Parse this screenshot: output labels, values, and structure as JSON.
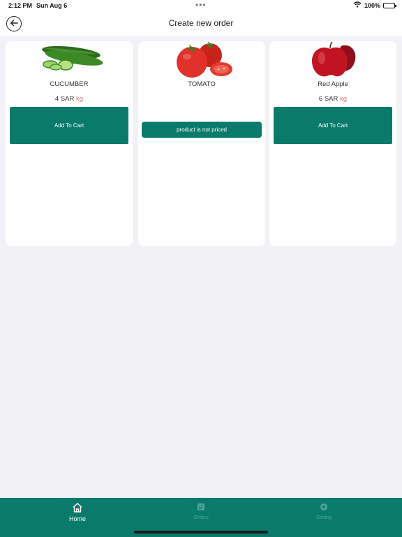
{
  "status_bar": {
    "time": "2:12 PM",
    "date": "Sun Aug 6",
    "dots": "•••",
    "battery_percent": "100%"
  },
  "header": {
    "title": "Create new order",
    "back_icon": "arrow-left-icon"
  },
  "products": [
    {
      "name": "CUCUMBER",
      "price": "4 SAR",
      "unit": "kg",
      "button": "Add To Cart",
      "image": "cucumber-image"
    },
    {
      "name": "TOMATO",
      "price": "",
      "unit": "",
      "button": "product is not priced",
      "image": "tomato-image"
    },
    {
      "name": "Red Apple",
      "price": "6 SAR",
      "unit": "kg",
      "button": "Add To Cart",
      "image": "red-apple-image"
    }
  ],
  "tabs": [
    {
      "label": "Home",
      "icon": "home-icon",
      "active": true
    },
    {
      "label": "Orders",
      "icon": "orders-icon",
      "active": false
    },
    {
      "label": "Setting",
      "icon": "gear-icon",
      "active": false
    }
  ],
  "colors": {
    "accent": "#0a7b6b",
    "background": "#f2f2f6",
    "unit": "#e07a7a"
  }
}
